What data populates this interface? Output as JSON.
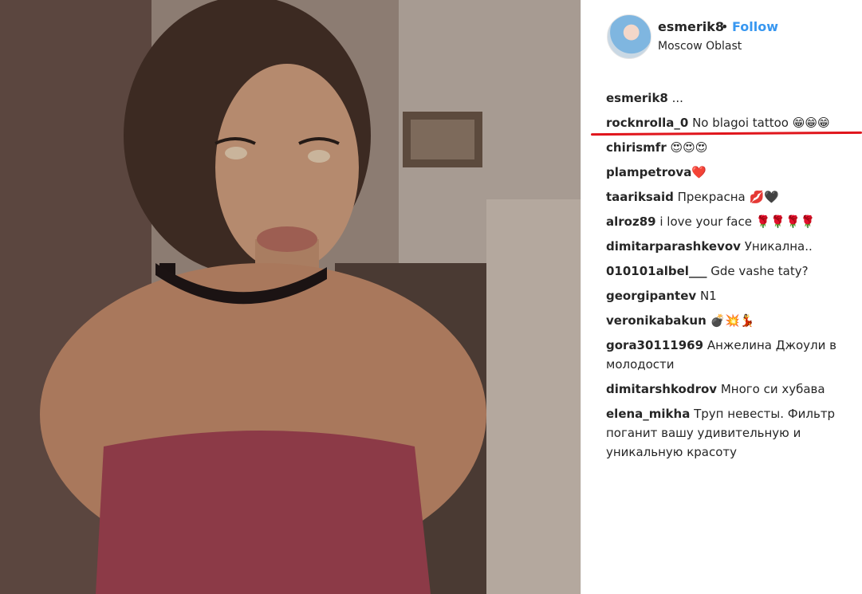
{
  "post": {
    "username": "esmerik8",
    "follow_label": "Follow",
    "separator": "•",
    "location": "Moscow Oblast"
  },
  "comments": [
    {
      "user": "esmerik8",
      "text": "..."
    },
    {
      "user": "rocknrolla_0",
      "text": "No blagoi tattoo 😁😁😁"
    },
    {
      "user": "chirismfr",
      "text": "😍😍😍"
    },
    {
      "user": "plampetrova",
      "text": "❤️"
    },
    {
      "user": "taariksaid",
      "text": "Прекрасна 💋🖤"
    },
    {
      "user": "alroz89",
      "text": "i love your face 🌹🌹🌹🌹"
    },
    {
      "user": "dimitarparashkevov",
      "text": "Уникална.."
    },
    {
      "user": "010101albel___",
      "text": "Gde vashe taty?"
    },
    {
      "user": "georgipantev",
      "text": "N1"
    },
    {
      "user": "veronikabakun",
      "text": "💣💥💃"
    },
    {
      "user": "gora30111969",
      "text": "Анжелина Джоули в молодости"
    },
    {
      "user": "dimitarshkodrov",
      "text": "Много си хубава"
    },
    {
      "user": "elena_mikha",
      "text": "Труп невесты. Фильтр поганит вашу удивительную и уникальную красоту"
    }
  ],
  "icons": {
    "photo": "portrait-photo",
    "avatar": "user-avatar"
  },
  "colors": {
    "follow": "#3897f0",
    "highlight_underline": "#e0151c"
  }
}
